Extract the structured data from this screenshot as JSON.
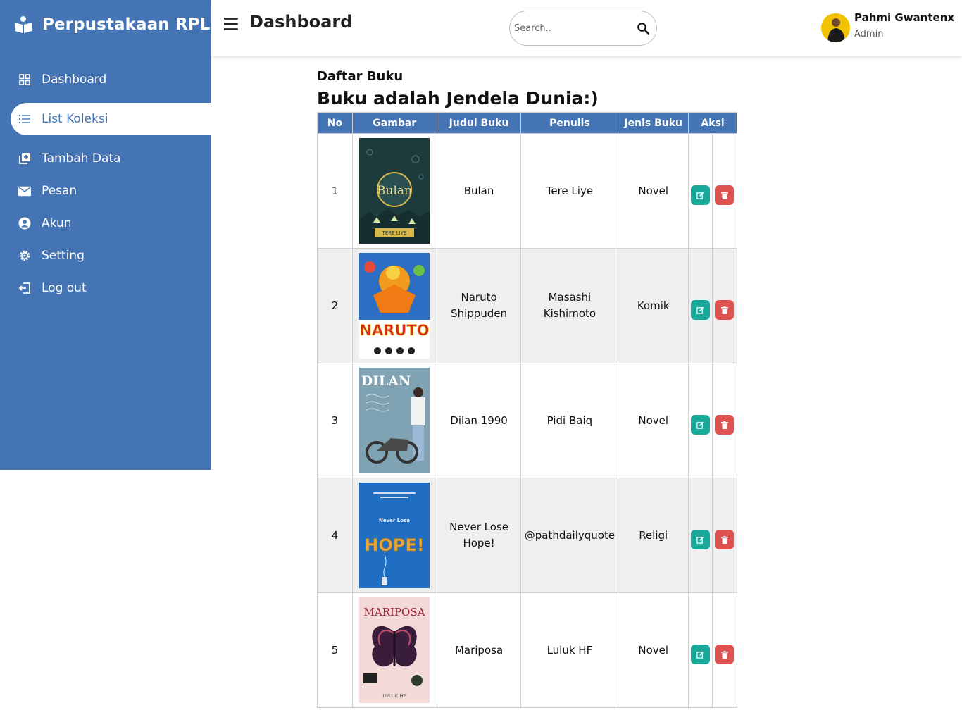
{
  "brand": {
    "name": "Perpustakaan RPL",
    "icon": "reader-icon"
  },
  "sidebar": {
    "items": [
      {
        "label": "Dashboard",
        "icon": "grid-icon"
      },
      {
        "label": "List Koleksi",
        "icon": "list-icon",
        "active": true
      },
      {
        "label": "Tambah Data",
        "icon": "add-box-icon"
      },
      {
        "label": "Pesan",
        "icon": "envelope-icon"
      },
      {
        "label": "Akun",
        "icon": "user-circle-icon"
      },
      {
        "label": "Setting",
        "icon": "gear-icon"
      },
      {
        "label": "Log out",
        "icon": "logout-icon"
      }
    ]
  },
  "topbar": {
    "title": "Dashboard",
    "search_placeholder": "Search..",
    "user_name": "Pahmi Gwantenx",
    "user_role": "Admin"
  },
  "content": {
    "label": "Daftar Buku",
    "heading": "Buku adalah Jendela Dunia:)"
  },
  "table": {
    "headers": [
      "No",
      "Gambar",
      "Judul Buku",
      "Penulis",
      "Jenis Buku",
      "Aksi"
    ],
    "rows": [
      {
        "no": "1",
        "title": "Bulan",
        "author": "Tere Liye",
        "genre": "Novel"
      },
      {
        "no": "2",
        "title": "Naruto Shippuden",
        "author": "Masashi Kishimoto",
        "genre": "Komik"
      },
      {
        "no": "3",
        "title": "Dilan 1990",
        "author": "Pidi Baiq",
        "genre": "Novel"
      },
      {
        "no": "4",
        "title": "Never Lose Hope!",
        "author": "@pathdailyquote",
        "genre": "Religi"
      },
      {
        "no": "5",
        "title": "Mariposa",
        "author": "Luluk HF",
        "genre": "Novel"
      }
    ]
  },
  "covers": {
    "bulan": {
      "text": "Bulan",
      "author": "TERE LIYE"
    },
    "naruto": {
      "text": "NARUTO"
    },
    "dilan": {
      "text": "DILAN"
    },
    "hope": {
      "text": "HOPE!",
      "small": "Never Lose"
    },
    "mariposa": {
      "text": "MARIPOSA",
      "author": "LULUK HF"
    }
  },
  "colors": {
    "primary": "#4474b4",
    "edit": "#1aa89a",
    "delete": "#e05151"
  }
}
